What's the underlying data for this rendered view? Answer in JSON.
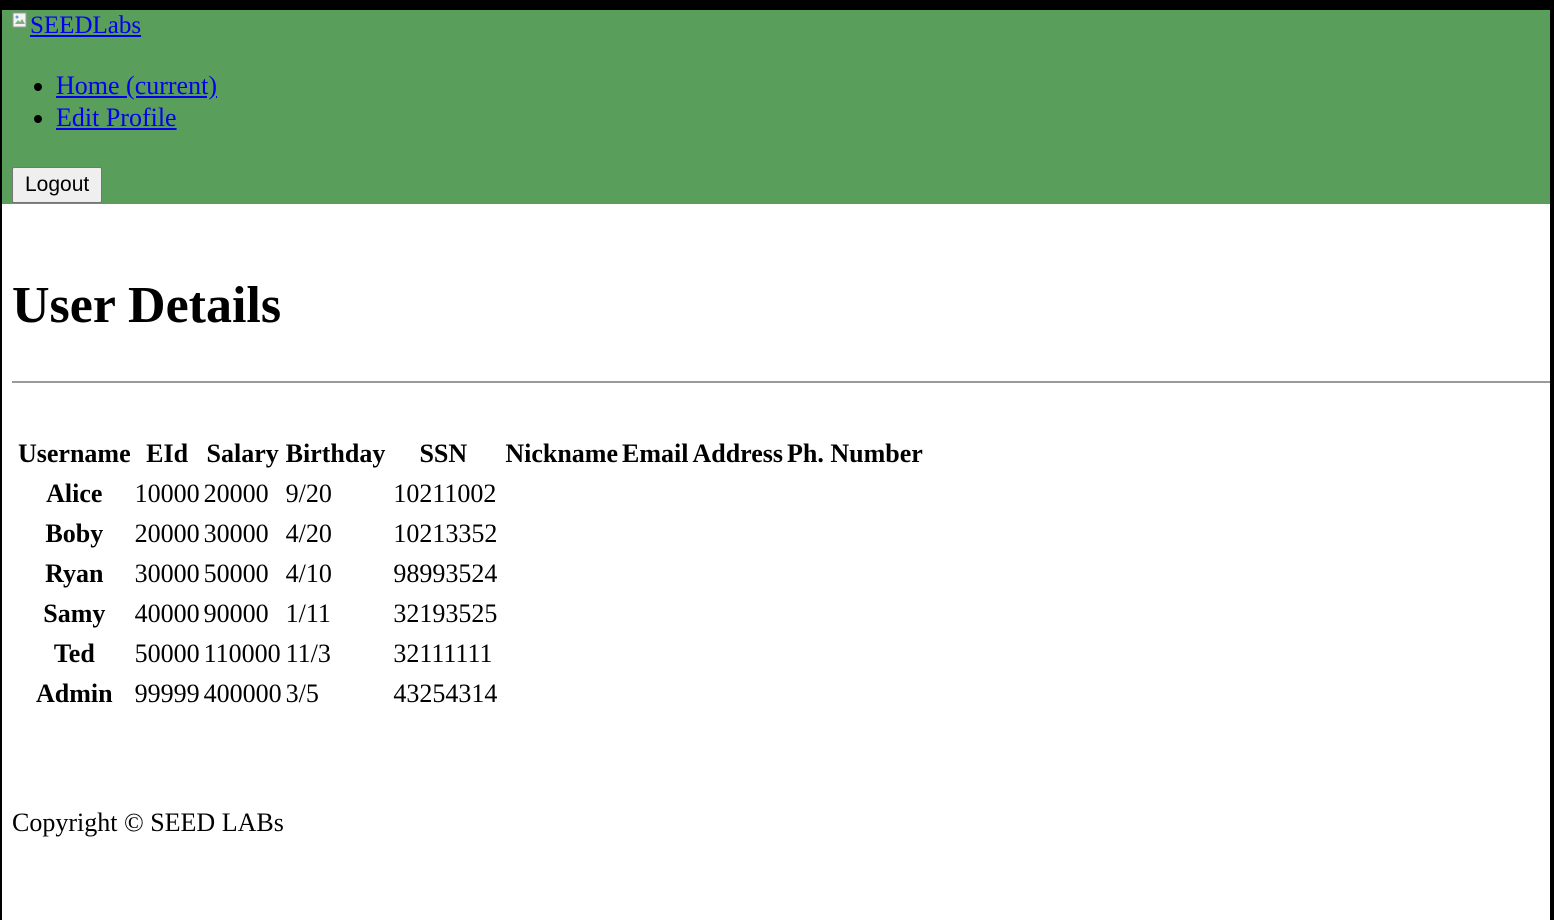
{
  "navbar": {
    "brand_label": "SEEDLabs",
    "background_color": "#5a9e5c",
    "links": [
      {
        "label": "Home (current)"
      },
      {
        "label": "Edit Profile"
      }
    ],
    "logout_label": "Logout"
  },
  "main": {
    "title": "User Details",
    "table": {
      "headers": [
        "Username",
        "EId",
        "Salary",
        "Birthday",
        "SSN",
        "Nickname",
        "Email",
        "Address",
        "Ph. Number"
      ],
      "rows": [
        {
          "username": "Alice",
          "eid": "10000",
          "salary": "20000",
          "birthday": "9/20",
          "ssn": "10211002",
          "nickname": "",
          "email": "",
          "address": "",
          "phone": ""
        },
        {
          "username": "Boby",
          "eid": "20000",
          "salary": "30000",
          "birthday": "4/20",
          "ssn": "10213352",
          "nickname": "",
          "email": "",
          "address": "",
          "phone": ""
        },
        {
          "username": "Ryan",
          "eid": "30000",
          "salary": "50000",
          "birthday": "4/10",
          "ssn": "98993524",
          "nickname": "",
          "email": "",
          "address": "",
          "phone": ""
        },
        {
          "username": "Samy",
          "eid": "40000",
          "salary": "90000",
          "birthday": "1/11",
          "ssn": "32193525",
          "nickname": "",
          "email": "",
          "address": "",
          "phone": ""
        },
        {
          "username": "Ted",
          "eid": "50000",
          "salary": "110000",
          "birthday": "11/3",
          "ssn": "32111111",
          "nickname": "",
          "email": "",
          "address": "",
          "phone": ""
        },
        {
          "username": "Admin",
          "eid": "99999",
          "salary": "400000",
          "birthday": "3/5",
          "ssn": "43254314",
          "nickname": "",
          "email": "",
          "address": "",
          "phone": ""
        }
      ]
    }
  },
  "footer": {
    "text": "Copyright © SEED LABs"
  }
}
